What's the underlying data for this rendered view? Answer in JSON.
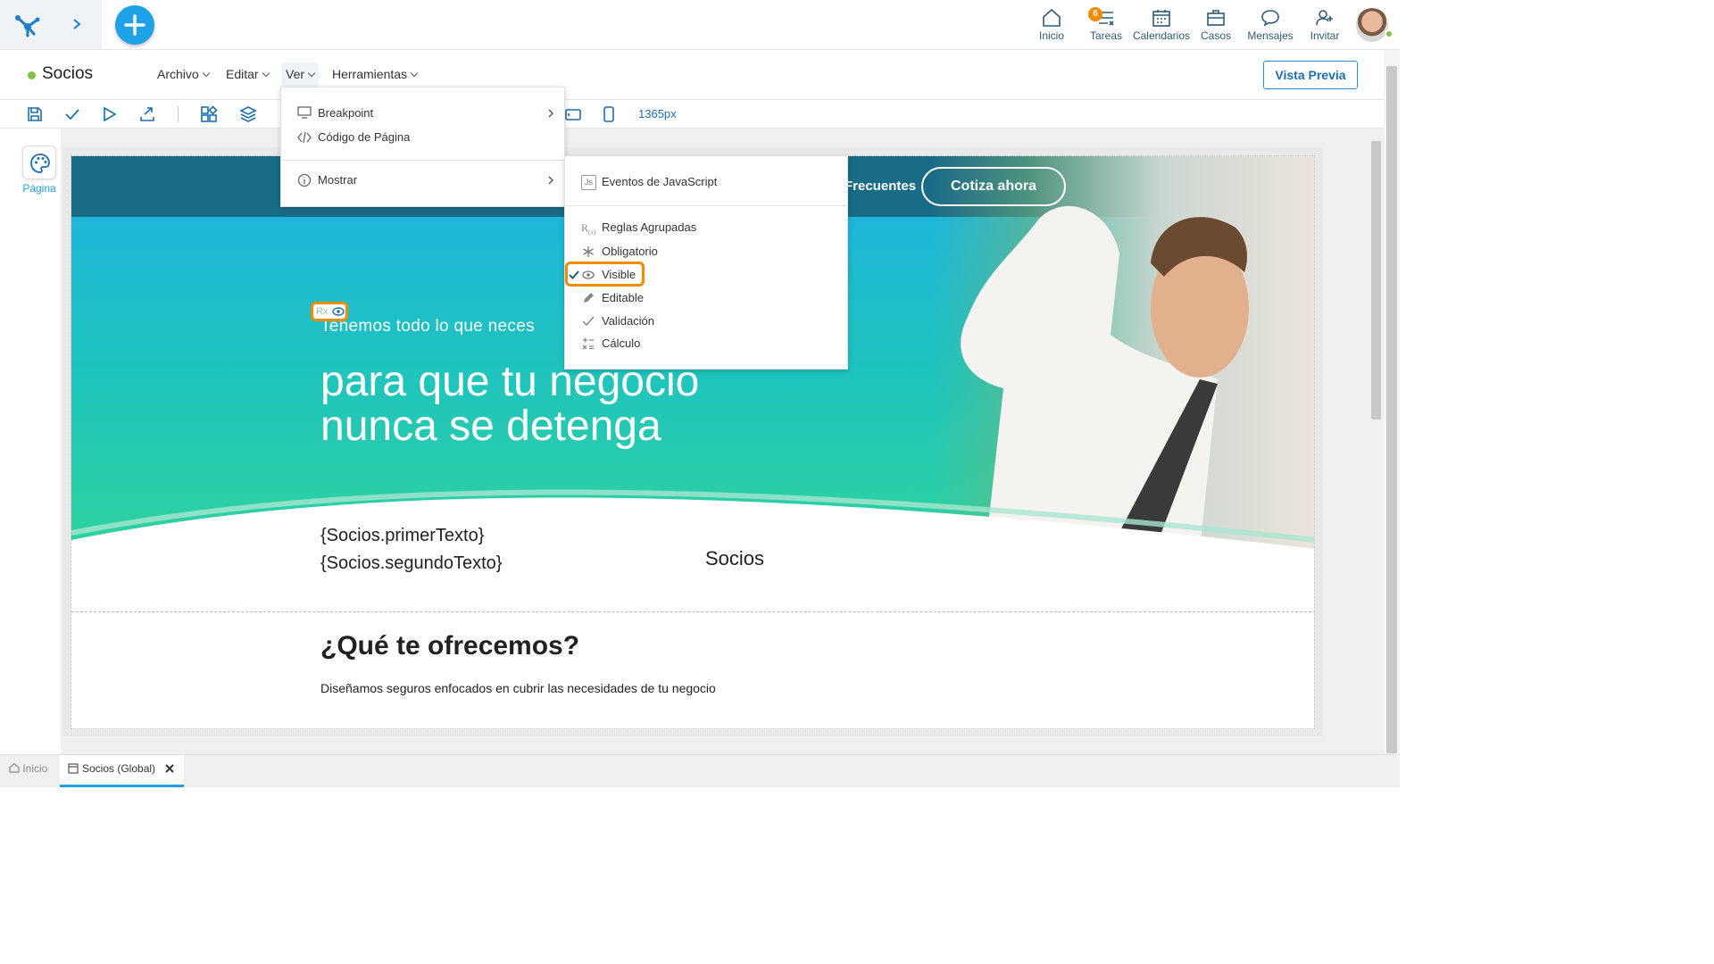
{
  "topnav": {
    "items": [
      {
        "label": "Inicio",
        "icon": "home-icon"
      },
      {
        "label": "Tareas",
        "icon": "tasks-icon",
        "badge": "6"
      },
      {
        "label": "Calendarios",
        "icon": "calendar-icon"
      },
      {
        "label": "Casos",
        "icon": "briefcase-icon"
      },
      {
        "label": "Mensajes",
        "icon": "chat-icon"
      },
      {
        "label": "Invitar",
        "icon": "add-user-icon"
      }
    ]
  },
  "titlebar": {
    "title": "Socios",
    "menus": [
      "Archivo",
      "Editar",
      "Ver",
      "Herramientas"
    ],
    "preview_button": "Vista Previa"
  },
  "toolbar": {
    "width_label": "1365px"
  },
  "leftpanel": {
    "page_label": "Página"
  },
  "ver_menu": {
    "items": [
      "Breakpoint",
      "Código de Página",
      "Mostrar"
    ]
  },
  "mostrar_submenu": {
    "items": [
      "Eventos de JavaScript",
      "Reglas Agrupadas",
      "Obligatorio",
      "Visible",
      "Editable",
      "Validación",
      "Cálculo"
    ]
  },
  "preview": {
    "nav_link": "Frecuentes",
    "cta": "Cotiza ahora",
    "subtitle": "Tenemos todo lo que neces",
    "title_line1": "para que tu negocio",
    "title_line2": "nunca se detenga",
    "rx_chip": "Rx",
    "placeholder1": "{Socios.primerTexto}",
    "placeholder2": "{Socios.segundoTexto}",
    "label": "Socios",
    "section_title": "¿Qué te ofrecemos?",
    "section_text": "Diseñamos seguros enfocados en cubrir las necesidades de tu negocio"
  },
  "tabs": [
    {
      "label": "Inicio"
    },
    {
      "label": "Socios (Global)"
    }
  ],
  "colors": {
    "accent": "#1ea1e6",
    "highlight": "#f08c00",
    "brand": "#1b6fb0"
  }
}
